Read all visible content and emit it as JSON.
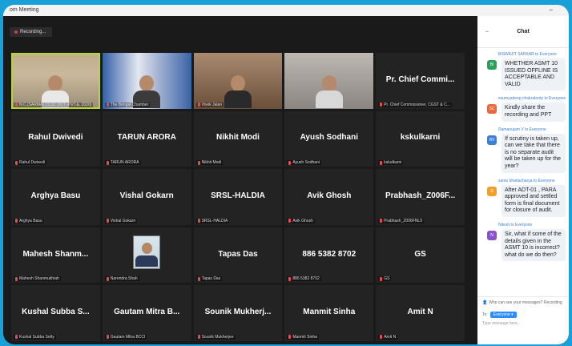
{
  "window": {
    "title": "om Meeting",
    "minimize": "–"
  },
  "recording": {
    "label": "Recording..."
  },
  "tiles": [
    {
      "big": "",
      "small": "N.C.(SARMA) CCST DOT (PVT.&. 2020)",
      "video": "v1",
      "active": true
    },
    {
      "big": "",
      "small": "The Bengal Chamber",
      "video": "v2"
    },
    {
      "big": "",
      "small": "Vivek Jalan",
      "video": "v3"
    },
    {
      "big": "",
      "small": "",
      "video": "v4"
    },
    {
      "big": "Pr. Chief Commi...",
      "small": "Pr. Chief Commissioner, CGST & C..."
    },
    {
      "big": "Rahul Dwivedi",
      "small": "Rahul Dwivedi"
    },
    {
      "big": "TARUN ARORA",
      "small": "TARUN ARORA"
    },
    {
      "big": "Nikhit Modi",
      "small": "Nikhit Modi"
    },
    {
      "big": "Ayush Sodhani",
      "small": "Ayush Sodhani"
    },
    {
      "big": "kskulkarni",
      "small": "kskulkarni"
    },
    {
      "big": "Arghya Basu",
      "small": "Arghya Basu"
    },
    {
      "big": "Vishal Gokarn",
      "small": "Vishal Gokarn"
    },
    {
      "big": "SRSL-HALDIA",
      "small": "SRSL-HALDIA"
    },
    {
      "big": "Avik Ghosh",
      "small": "Avik Ghosh"
    },
    {
      "big": "Prabhash_Z006F...",
      "small": "Prabhash_Z006FNL9"
    },
    {
      "big": "Mahesh  Shanm...",
      "small": "Mahesh Shanmukhiah"
    },
    {
      "big": "",
      "small": "Narendra Shah",
      "photo": true
    },
    {
      "big": "Tapas Das",
      "small": "Tapas Das"
    },
    {
      "big": "886 5382 8702",
      "small": "886 5382 8702"
    },
    {
      "big": "GS",
      "small": "GS"
    },
    {
      "big": "Kushal Subba S...",
      "small": "Kushal Subba Setty"
    },
    {
      "big": "Gautam  Mitra  B...",
      "small": "Gautam Mitra BCCI"
    },
    {
      "big": "Sounik  Mukherj...",
      "small": "Sounik Mukherjee"
    },
    {
      "big": "Manmit Sinha",
      "small": "Manmit Sinha"
    },
    {
      "big": "Amit N",
      "small": "Amit N"
    }
  ],
  "chat": {
    "title": "Chat",
    "messages": [
      {
        "from": "BISWAJIT SARKAR to Everyone",
        "initials": "BI",
        "color": "#2e9f5b",
        "text": "WHETHER ASMT 10 ISSUED OFFLINE IS ACCEPTABLE AND VALID"
      },
      {
        "from": "soumyadeep chakraborty to Everyone",
        "initials": "SC",
        "color": "#e9693a",
        "text": "Kindly share the recording and PPT"
      },
      {
        "from": "Ramanujam V to Everyone",
        "initials": "RV",
        "color": "#3b82d6",
        "text": "If scrutiny is taken up, can we take that there is no separate audit will be taken up for the year?"
      },
      {
        "from": "santu bhattacharya to Everyone",
        "initials": "S",
        "color": "#f0a12a",
        "text": "After ADT-01 , PARA approved and settled form is final document for closure of audit."
      },
      {
        "from": "Nitesh to Everyone",
        "initials": "N",
        "color": "#8a53c9",
        "text": "Sir, what if some of the details given in the ASMT 10 is incorrect? what do we do then?"
      }
    ],
    "footer": {
      "note": "Who can see your messages? Recording",
      "to_label": "To:",
      "to_value": "Everyone",
      "placeholder": "Type message here..."
    }
  }
}
